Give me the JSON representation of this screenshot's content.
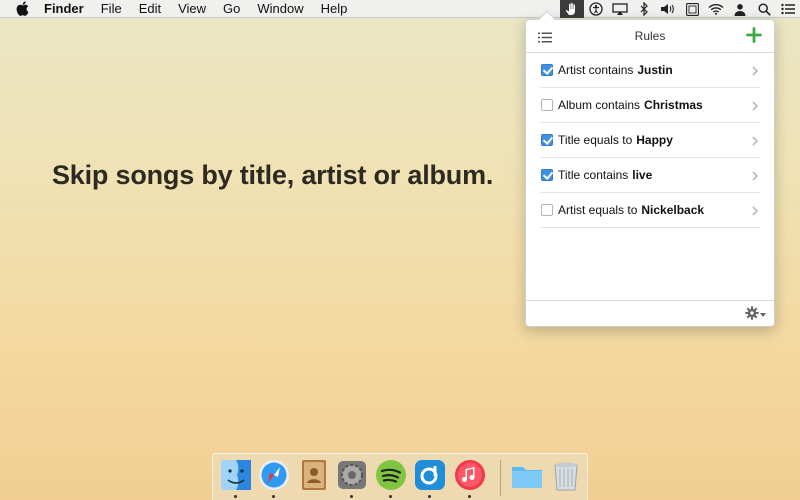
{
  "menubar": {
    "app_name": "Finder",
    "items": [
      "File",
      "Edit",
      "View",
      "Go",
      "Window",
      "Help"
    ],
    "status_icons": [
      "hand-icon",
      "accessibility-icon",
      "airplay-icon",
      "bluetooth-icon",
      "volume-icon",
      "keyboard-layout-icon",
      "wifi-icon",
      "user-icon",
      "spotlight-search-icon",
      "notification-list-icon"
    ]
  },
  "headline": "Skip songs by title, artist or album.",
  "popover": {
    "title": "Rules",
    "rules": [
      {
        "checked": true,
        "text": "Artist contains",
        "value": "Justin"
      },
      {
        "checked": false,
        "text": "Album contains",
        "value": "Christmas"
      },
      {
        "checked": true,
        "text": "Title equals to",
        "value": "Happy"
      },
      {
        "checked": true,
        "text": "Title contains",
        "value": "live"
      },
      {
        "checked": false,
        "text": "Artist equals to",
        "value": "Nickelback"
      }
    ]
  },
  "dock": {
    "apps": [
      "finder-icon",
      "safari-icon",
      "contacts-icon",
      "system-preferences-icon",
      "spotify-icon",
      "rdio-icon",
      "itunes-icon"
    ],
    "others": [
      "downloads-folder-icon",
      "trash-icon"
    ]
  },
  "colors": {
    "accent": "#3f8fe6",
    "add_green": "#3daa3d",
    "headline": "#2d2a22"
  }
}
